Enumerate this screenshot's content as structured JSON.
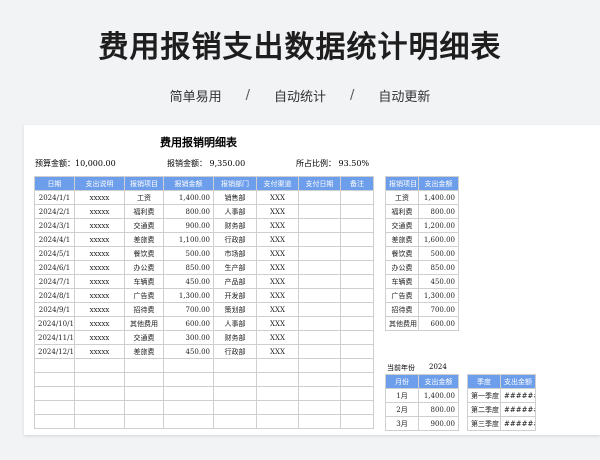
{
  "header": {
    "title": "费用报销支出数据统计明细表",
    "tags": [
      "简单易用",
      "自动统计",
      "自动更新"
    ],
    "separator": "/"
  },
  "sheet": {
    "title": "费用报销明细表",
    "budget_label": "预算金额：10,000.00",
    "reimbursed_label": "报销金额：  9,350.00",
    "ratio_label": "所占比例：  93.50%",
    "main_headers": [
      "日期",
      "支出说明",
      "报销项目",
      "报销金额",
      "报销部门",
      "支付渠道",
      "支付日期",
      "备注"
    ],
    "rows": [
      [
        "2024/1/1",
        "xxxxx",
        "工资",
        "1,400.00",
        "销售部",
        "XXX"
      ],
      [
        "2024/2/1",
        "xxxxx",
        "福利费",
        "800.00",
        "人事部",
        "XXX"
      ],
      [
        "2024/3/1",
        "xxxxx",
        "交通费",
        "900.00",
        "财务部",
        "XXX"
      ],
      [
        "2024/4/1",
        "xxxxx",
        "差旅费",
        "1,100.00",
        "行政部",
        "XXX"
      ],
      [
        "2024/5/1",
        "xxxxx",
        "餐饮费",
        "500.00",
        "市场部",
        "XXX"
      ],
      [
        "2024/6/1",
        "xxxxx",
        "办公费",
        "850.00",
        "生产部",
        "XXX"
      ],
      [
        "2024/7/1",
        "xxxxx",
        "车辆费",
        "450.00",
        "产品部",
        "XXX"
      ],
      [
        "2024/8/1",
        "xxxxx",
        "广告费",
        "1,300.00",
        "开发部",
        "XXX"
      ],
      [
        "2024/9/1",
        "xxxxx",
        "招待费",
        "700.00",
        "策划部",
        "XXX"
      ],
      [
        "2024/10/1",
        "xxxxx",
        "其他费用",
        "600.00",
        "人事部",
        "XXX"
      ],
      [
        "2024/11/1",
        "xxxxx",
        "交通费",
        "300.00",
        "财务部",
        "XXX"
      ],
      [
        "2024/12/1",
        "xxxxx",
        "差旅费",
        "450.00",
        "行政部",
        "XXX"
      ]
    ],
    "empty_rows": 5,
    "item_summary": {
      "headers": [
        "报销项目",
        "支出金额"
      ],
      "rows": [
        [
          "工资",
          "1,400.00"
        ],
        [
          "福利费",
          "800.00"
        ],
        [
          "交通费",
          "1,200.00"
        ],
        [
          "差旅费",
          "1,600.00"
        ],
        [
          "餐饮费",
          "500.00"
        ],
        [
          "办公费",
          "850.00"
        ],
        [
          "车辆费",
          "450.00"
        ],
        [
          "广告费",
          "1,300.00"
        ],
        [
          "招待费",
          "700.00"
        ],
        [
          "其他费用",
          "600.00"
        ]
      ]
    },
    "current_year_label": "当前年份",
    "current_year": "2024",
    "month_summary": {
      "headers": [
        "月份",
        "支出金额"
      ],
      "rows": [
        [
          "1月",
          "1,400.00"
        ],
        [
          "2月",
          "800.00"
        ],
        [
          "3月",
          "900.00"
        ]
      ]
    },
    "quarter_summary": {
      "headers": [
        "季度",
        "支出金额"
      ],
      "rows": [
        [
          "第一季度",
          "########"
        ],
        [
          "第二季度",
          "########"
        ],
        [
          "第三季度",
          "########"
        ]
      ]
    }
  }
}
